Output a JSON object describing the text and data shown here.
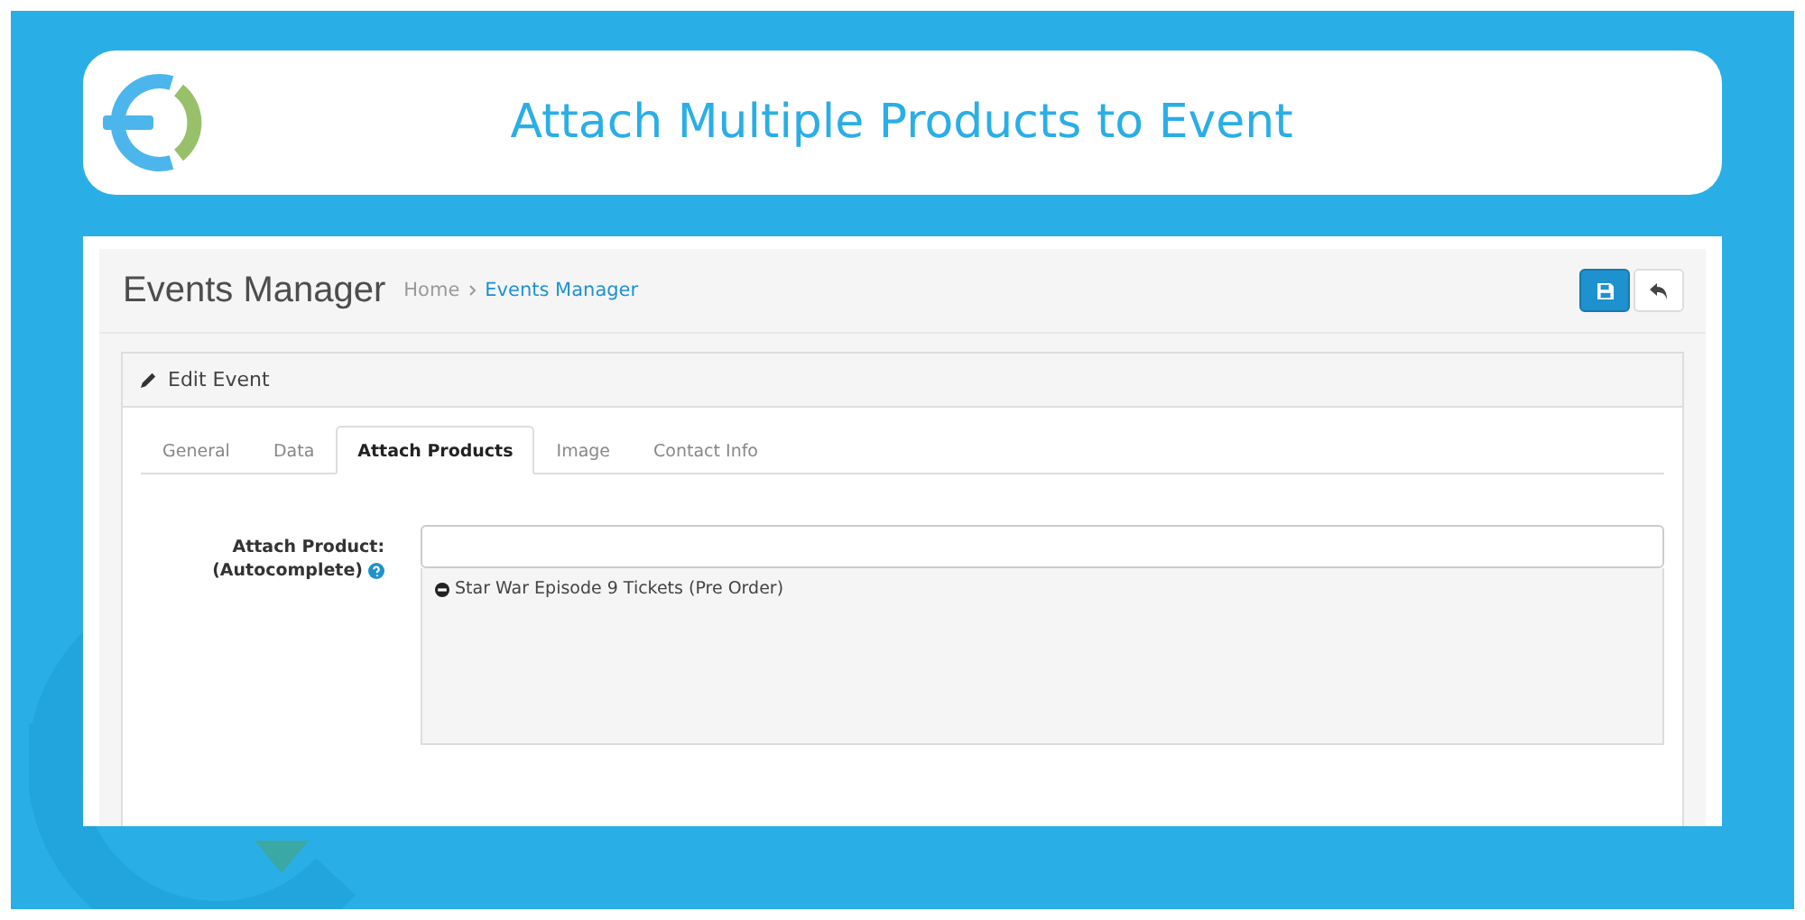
{
  "banner": {
    "title": "Attach Multiple Products to Event"
  },
  "page": {
    "title": "Events Manager",
    "breadcrumbs": [
      {
        "label": "Home",
        "current": false
      },
      {
        "label": "Events Manager",
        "current": true
      }
    ]
  },
  "actions": [
    {
      "kind": "save",
      "primary": true
    },
    {
      "kind": "back",
      "primary": false
    }
  ],
  "panel": {
    "title": "Edit Event"
  },
  "tabs": [
    {
      "label": "General",
      "selected": false
    },
    {
      "label": "Data",
      "selected": false
    },
    {
      "label": "Attach Products",
      "selected": true
    },
    {
      "label": "Image",
      "selected": false
    },
    {
      "label": "Contact Info",
      "selected": false
    }
  ],
  "form": {
    "label": "Attach Product:",
    "sublabel": "(Autocomplete)",
    "products": [
      {
        "name": "Star War Episode 9 Tickets (Pre Order)"
      }
    ]
  }
}
